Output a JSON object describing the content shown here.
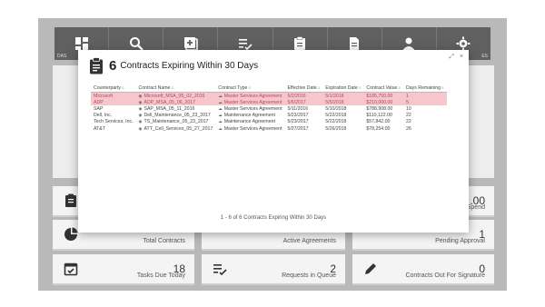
{
  "nav": {
    "items": [
      {
        "icon": "dashboard-icon",
        "caption": "DAS"
      },
      {
        "icon": "search-icon",
        "caption": ""
      },
      {
        "icon": "add-document-icon",
        "caption": ""
      },
      {
        "icon": "checklist-icon",
        "caption": ""
      },
      {
        "icon": "clipboard-icon",
        "caption": ""
      },
      {
        "icon": "document-icon",
        "caption": ""
      },
      {
        "icon": "user-icon",
        "caption": ""
      },
      {
        "icon": "gear-icon",
        "caption": "ES"
      }
    ]
  },
  "cards": {
    "spend": {
      "value": ".00",
      "label": "Spend"
    },
    "total_contracts": {
      "value": "",
      "label": "Total Contracts"
    },
    "active_agreements": {
      "value": "",
      "label": "Active Agreements"
    },
    "pending_approval": {
      "value": "1",
      "label": "Pending Approval"
    },
    "tasks_due": {
      "value": "18",
      "label": "Tasks Due Today"
    },
    "requests": {
      "value": "2",
      "label": "Requests in Queue"
    },
    "signature": {
      "value": "0",
      "label": "Contracts Out For Signature"
    }
  },
  "modal": {
    "count": "6",
    "title": "Contracts Expiring Within 30 Days",
    "expand_glyph": "⤢",
    "close_glyph": "×",
    "columns": [
      "Counterparty",
      "Contract Name",
      "Contract Type",
      "Effective Date",
      "Expiration Date",
      "Contract Value",
      "Days Remaining"
    ],
    "rows": [
      {
        "counterparty": "Microsoft",
        "name": "Microsoft_MSA_05_02_2016",
        "type": "Master Services Agreement",
        "effective": "5/2/2016",
        "expiration": "5/1/2018",
        "value": "$185,750.00",
        "days": "1",
        "highlight": true
      },
      {
        "counterparty": "ADP",
        "name": "ADP_MSA_05_06_2017",
        "type": "Master Services Agreement",
        "effective": "5/6/2017",
        "expiration": "5/5/2018",
        "value": "$210,000.00",
        "days": "5",
        "highlight": true
      },
      {
        "counterparty": "SAP",
        "name": "SAP_MSA_05_11_2016",
        "type": "Master Services Agreement",
        "effective": "5/11/2016",
        "expiration": "5/10/2018",
        "value": "$788,908.00",
        "days": "10",
        "highlight": false
      },
      {
        "counterparty": "Dell, Inc.",
        "name": "Dell_Maintenance_05_23_2017",
        "type": "Maintenance Agreement",
        "effective": "5/23/2017",
        "expiration": "5/22/2018",
        "value": "$110,122.00",
        "days": "22",
        "highlight": false
      },
      {
        "counterparty": "Tech Services, Inc.",
        "name": "TS_Maintenance_05_23_2017",
        "type": "Maintenance Agreement",
        "effective": "5/23/2017",
        "expiration": "5/22/2018",
        "value": "$57,842.00",
        "days": "22",
        "highlight": false
      },
      {
        "counterparty": "AT&T",
        "name": "ATT_Cell_Services_05_27_2017",
        "type": "Master Services Agreement",
        "effective": "5/27/2017",
        "expiration": "5/26/2018",
        "value": "$78,254.00",
        "days": "26",
        "highlight": false
      }
    ],
    "footer": "1 - 6 of 6 Contracts Expiring Within 30 Days"
  },
  "colors": {
    "nav_bg": "#606060",
    "frame_bg": "#b9b9b9",
    "highlight_bg": "#f6c6cc",
    "highlight_text": "#b04a55"
  }
}
